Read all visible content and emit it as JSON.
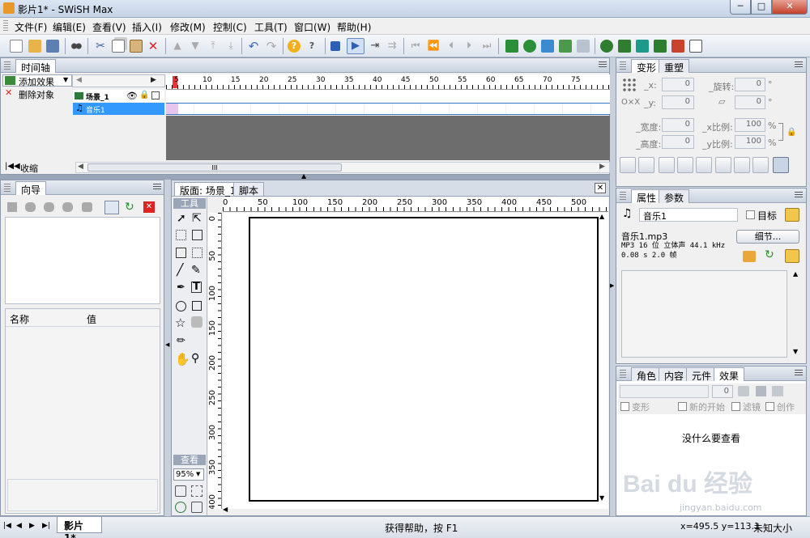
{
  "window": {
    "title": "影片1* - SWiSH Max",
    "min": "─",
    "max": "□",
    "close": "✕"
  },
  "menu": [
    "文件(F)",
    "编辑(E)",
    "查看(V)",
    "插入(I)",
    "修改(M)",
    "控制(C)",
    "工具(T)",
    "窗口(W)",
    "帮助(H)"
  ],
  "timeline": {
    "tab": "时间轴",
    "add_effect": "添加效果",
    "remove_object": "删除对象",
    "collapse": "收缩",
    "rows": [
      {
        "name": "场景_1"
      },
      {
        "name": "音乐1"
      }
    ],
    "frame_ticks": [
      "5",
      "10",
      "15",
      "20",
      "25",
      "30",
      "35",
      "40",
      "45",
      "50",
      "55",
      "60",
      "65",
      "70",
      "75"
    ],
    "hscroll": "III"
  },
  "guide": {
    "tab": "向导",
    "col_name": "名称",
    "col_value": "值"
  },
  "stage": {
    "tab_main": "版面: 场景_1",
    "tab_script": "脚本",
    "tools_label": "工具",
    "view_label": "查看",
    "zoom": "95%",
    "h_ticks": [
      "0",
      "50",
      "100",
      "150",
      "200",
      "250",
      "300",
      "350",
      "400",
      "450",
      "500"
    ],
    "v_ticks": [
      "0",
      "50",
      "100",
      "150",
      "200",
      "250",
      "300",
      "350",
      "400"
    ]
  },
  "transform": {
    "tab_active": "变形",
    "tab_other": "重塑",
    "x_label": "_x:",
    "x": "0",
    "y_label": "_y:",
    "y": "0",
    "rot_label": "_旋转:",
    "rot": "0",
    "rot_unit": "°",
    "skew": "0",
    "skew_unit": "°",
    "w_label": "_宽度:",
    "w": "0",
    "h_label": "_高度:",
    "h": "0",
    "xs_label": "_x比例:",
    "xs": "100",
    "xs_unit": "%",
    "ys_label": "_y比例:",
    "ys": "100",
    "ys_unit": "%",
    "ox_label": "O×X"
  },
  "properties": {
    "tab_active": "属性",
    "tab_other": "参数",
    "name": "音乐1",
    "target": "目标",
    "file": "音乐1.mp3",
    "format": "MP3 16 位 立体声 44.1 kHz",
    "duration": "0.08 s 2.0 帧",
    "details": "细节..."
  },
  "effects": {
    "tabs": [
      "角色",
      "内容",
      "元件",
      "效果"
    ],
    "value": "0",
    "checks": [
      "变形",
      "新的开始",
      "滤镜",
      "创作"
    ],
    "empty_msg": "没什么要查看"
  },
  "statusbar": {
    "doc_tab": "影片1*",
    "help": "获得帮助，按 F1",
    "coords": "x=495.5 y=113.1",
    "size": "未知大小"
  },
  "watermark": {
    "brand": "Bai du 经验",
    "url": "jingyan.baidu.com"
  },
  "colors": {
    "accent": "#3a78c4",
    "selection": "#3399ff",
    "timeline_dark": "#6d6d6d"
  }
}
